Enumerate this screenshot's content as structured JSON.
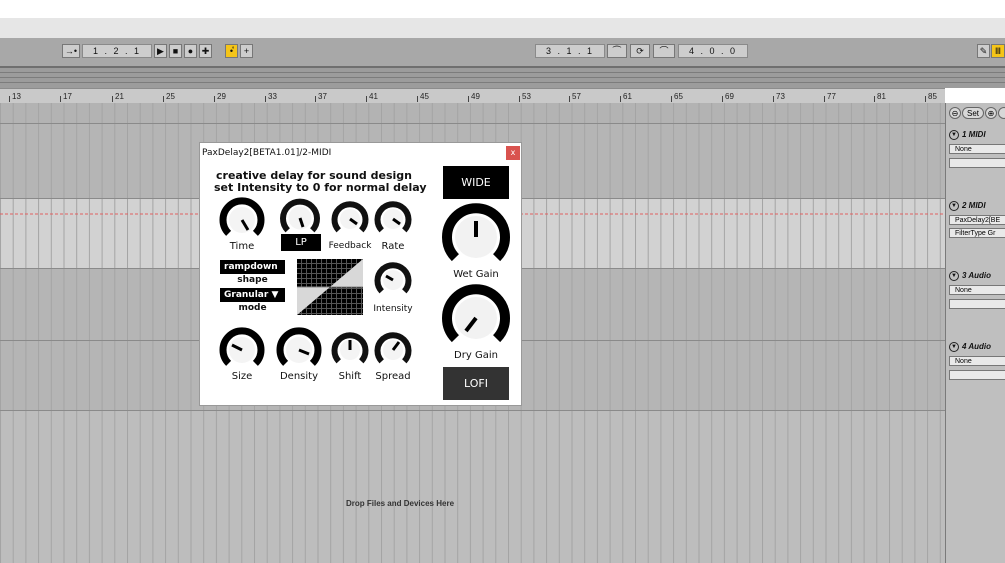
{
  "transport": {
    "follow_icon": "→•",
    "position": "1 .  2 .  1",
    "loop_start": "3 .  1 .  1",
    "loop_length": "4 .  0 .  0"
  },
  "ruler": {
    "ticks": [
      "13",
      "17",
      "21",
      "25",
      "29",
      "33",
      "37",
      "41",
      "45",
      "49",
      "53",
      "57",
      "61",
      "65",
      "69",
      "73",
      "77",
      "81",
      "85"
    ]
  },
  "arrangement": {
    "drop_text": "Drop Files and Devices Here"
  },
  "mixer": {
    "set_label": "Set",
    "tracks": [
      {
        "name": "1 MIDI",
        "device": "None"
      },
      {
        "name": "2 MIDI",
        "device": "PaxDelay2[BE",
        "param": "FilterType Gr"
      },
      {
        "name": "3 Audio",
        "device": "None"
      },
      {
        "name": "4 Audio",
        "device": "None"
      }
    ]
  },
  "plugin": {
    "title": "PaxDelay2[BETA1.01]/2-MIDI",
    "close": "x",
    "heading_line1": "creative delay for sound design",
    "heading_line2": "set Intensity to 0 for normal delay",
    "wide_label": "WIDE",
    "lofi_label": "LOFI",
    "lp_label": "LP",
    "knobs": {
      "time": "Time",
      "feedback": "Feedback",
      "rate": "Rate",
      "intensity": "Intensity",
      "size": "Size",
      "density": "Density",
      "shift": "Shift",
      "spread": "Spread",
      "wet_gain": "Wet Gain",
      "dry_gain": "Dry Gain"
    },
    "shape_value": "rampdown ▼",
    "shape_label": "shape",
    "mode_value": "Granular ▼",
    "mode_label": "mode"
  },
  "colors": {
    "accent": "#f5c518",
    "close": "#d9534f",
    "panel_black": "#000000",
    "lofi_bg": "#333333"
  }
}
